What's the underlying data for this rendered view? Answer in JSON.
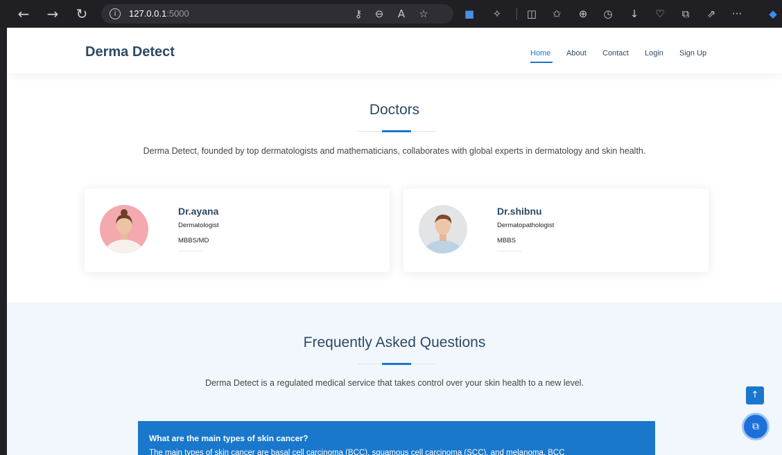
{
  "browser": {
    "url_host": "127.0.0.1",
    "url_port": ":5000",
    "icons": [
      "back-icon",
      "forward-icon",
      "refresh-icon",
      "info-icon",
      "key-icon",
      "zoom-icon",
      "read-aloud-icon",
      "favorite-star-icon",
      "translate-icon",
      "extensions-icon",
      "split-screen-icon",
      "favorites-icon",
      "collections-icon",
      "history-icon",
      "download-icon",
      "health-icon",
      "screenshot-icon",
      "share-icon",
      "more-icon"
    ]
  },
  "header": {
    "logo": "Derma Detect",
    "nav": [
      "Home",
      "About",
      "Contact",
      "Login",
      "Sign Up"
    ],
    "active_nav": "Home"
  },
  "doctors": {
    "title": "Doctors",
    "description": "Derma Detect, founded by top dermatologists and mathematicians, collaborates with global experts in dermatology and skin health.",
    "cards": [
      {
        "name": "Dr.ayana",
        "role": "Dermatologist",
        "degree": "MBBS/MD"
      },
      {
        "name": "Dr.shibnu",
        "role": "Dermatopathologist",
        "degree": "MBBS"
      }
    ]
  },
  "faq": {
    "title": "Frequently Asked Questions",
    "description": "Derma Detect is a regulated medical service that takes control over your skin health to a new level.",
    "items": [
      {
        "question": "What are the main types of skin cancer?",
        "answer": "The main types of skin cancer are basal cell carcinoma (BCC), squamous cell carcinoma (SCC), and melanoma. BCC"
      }
    ]
  },
  "floating": {
    "back_to_top_icon": "arrow-up-icon",
    "chat_icon": "chat-icon"
  },
  "colors": {
    "accent": "#1977cc",
    "heading": "#2c4964",
    "faq_bg": "#f1f7fd"
  }
}
